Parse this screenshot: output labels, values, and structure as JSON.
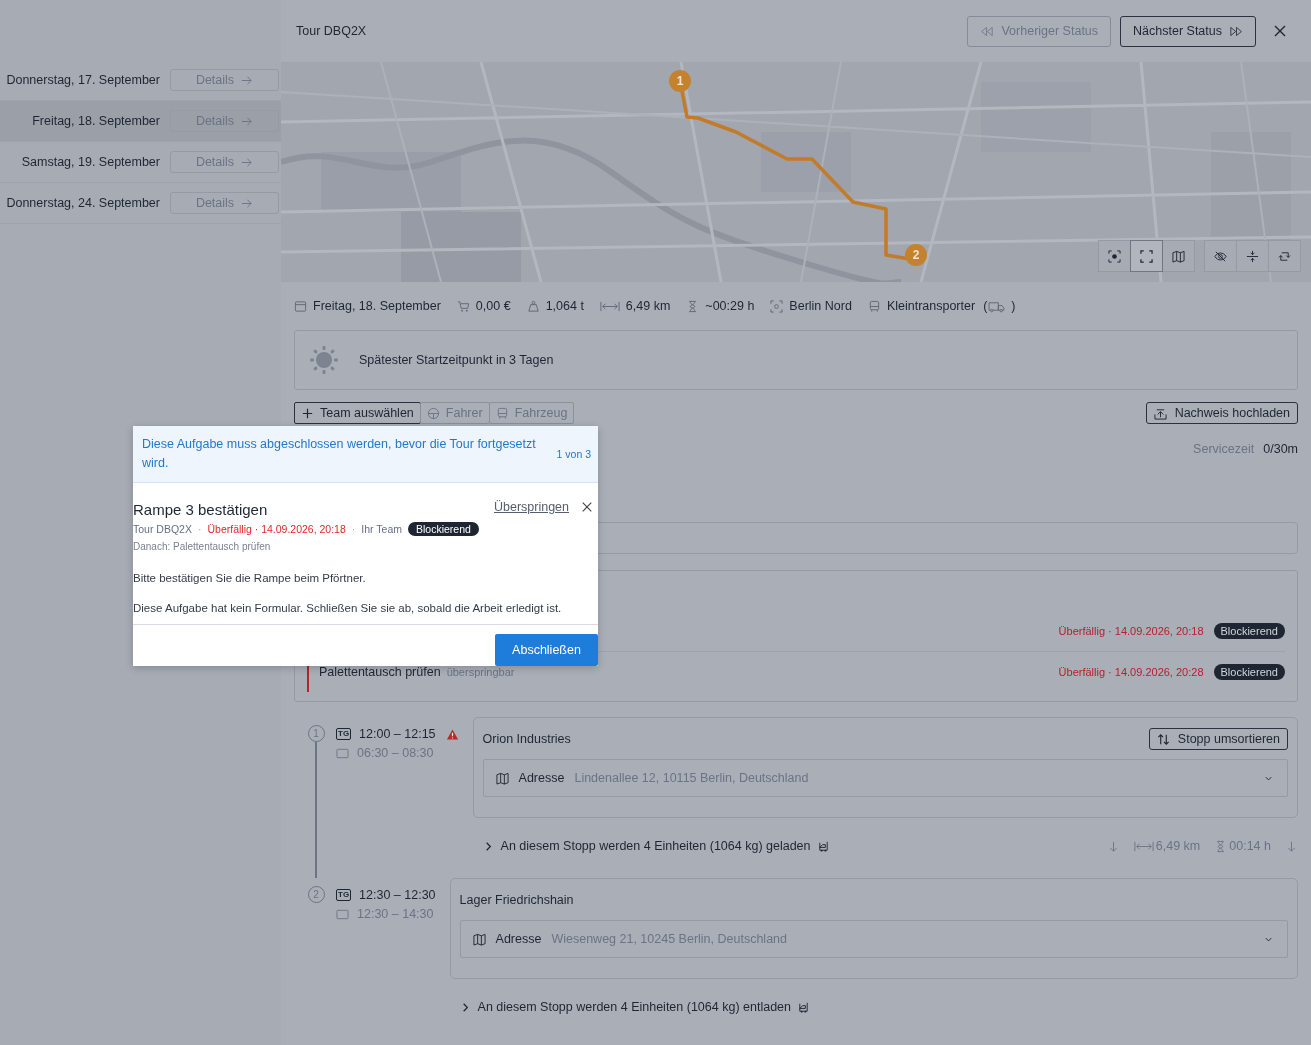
{
  "days": [
    {
      "label": "Donnerstag, 17. September",
      "button": "Details",
      "selected": false
    },
    {
      "label": "Freitag, 18. September",
      "button": "Details",
      "selected": true
    },
    {
      "label": "Samstag, 19. September",
      "button": "Details",
      "selected": false
    },
    {
      "label": "Donnerstag, 24. September",
      "button": "Details",
      "selected": false
    }
  ],
  "header": {
    "title": "Tour DBQ2X",
    "buttons": [
      {
        "label": "Vorheriger Status",
        "kind": "previous",
        "disabled": true
      },
      {
        "label": "Nächster Status",
        "kind": "next",
        "disabled": false
      }
    ]
  },
  "map": {
    "kind": "picture",
    "markers": [
      "1",
      "2"
    ],
    "controls": [
      {
        "kind": "focus",
        "selected": false
      },
      {
        "kind": "fullscreen",
        "selected": true
      },
      {
        "kind": "map",
        "selected": false
      },
      {
        "kind": "hide",
        "selected": false
      },
      {
        "kind": "split",
        "selected": false
      },
      {
        "kind": "rotate",
        "selected": false
      }
    ]
  },
  "summary": [
    {
      "kind": "calendar",
      "text": "Freitag, 18. September"
    },
    {
      "kind": "cart",
      "text": "0,00 €"
    },
    {
      "kind": "weight",
      "text": "1,064 t"
    },
    {
      "kind": "distance",
      "text": "6,49 km"
    },
    {
      "kind": "duration",
      "text": "~00:29 h"
    },
    {
      "kind": "depot",
      "text": "Berlin Nord"
    },
    {
      "kind": "vehicle",
      "text": "Kleintransporter",
      "open": "(",
      "close": ")"
    }
  ],
  "notice": {
    "text": "Spätester Startzeitpunkt in 3 Tagen"
  },
  "assign_tabs": [
    {
      "label": "Team auswählen",
      "kind": "team",
      "disabled": false
    },
    {
      "label": "Fahrer",
      "kind": "driver",
      "disabled": true
    },
    {
      "label": "Fahrzeug",
      "kind": "vehicle",
      "disabled": true
    }
  ],
  "upload_button": "Nachweis hochladen",
  "service_time": {
    "label": "Servicezeit",
    "value": "0/30m"
  },
  "tasks": [
    {
      "status": "Überfällig · 14.09.2026, 20:18",
      "badge": "Blockierend"
    },
    {
      "title": "Palettentausch prüfen",
      "note": "überspringbar",
      "status": "Überfällig · 14.09.2026, 20:28",
      "badge": "Blockierend"
    }
  ],
  "stops": [
    {
      "number": "1",
      "tag": "TG",
      "planned": "12:00 – 12:15",
      "warning": true,
      "window": "06:30 – 08:30",
      "name": "Orion Industries",
      "action": "Stopp umsortieren",
      "address_label": "Adresse",
      "address": "Lindenallee 12, 10115 Berlin, Deutschland",
      "load": "An diesem Stopp werden 4 Einheiten (1064 kg) geladen",
      "leg": {
        "distance": "6,49 km",
        "duration": "00:14 h"
      }
    },
    {
      "number": "2",
      "tag": "TG",
      "planned": "12:30 – 12:30",
      "warning": false,
      "window": "12:30 – 14:30",
      "name": "Lager Friedrichshain",
      "address_label": "Adresse",
      "address": "Wiesenweg 21, 10245 Berlin, Deutschland",
      "load": "An diesem Stopp werden 4 Einheiten (1064 kg) entladen"
    }
  ],
  "popup": {
    "notice": "Diese Aufgabe muss abgeschlossen werden, bevor die Tour fortgesetzt wird.",
    "counter": "1 von 3",
    "title": "Rampe 3 bestätigen",
    "skip": "Überspringen",
    "separator": "·",
    "tour": "Tour DBQ2X",
    "due": "Überfällig · 14.09.2026, 20:18",
    "team": "Ihr Team",
    "badge": "Blockierend",
    "next": "Danach: Palettentausch prüfen",
    "body": [
      "Bitte bestätigen Sie die Rampe beim Pförtner.",
      "Diese Aufgabe hat kein Formular. Schließen Sie sie ab, sobald die Arbeit erledigt ist."
    ],
    "button": "Abschließen"
  }
}
